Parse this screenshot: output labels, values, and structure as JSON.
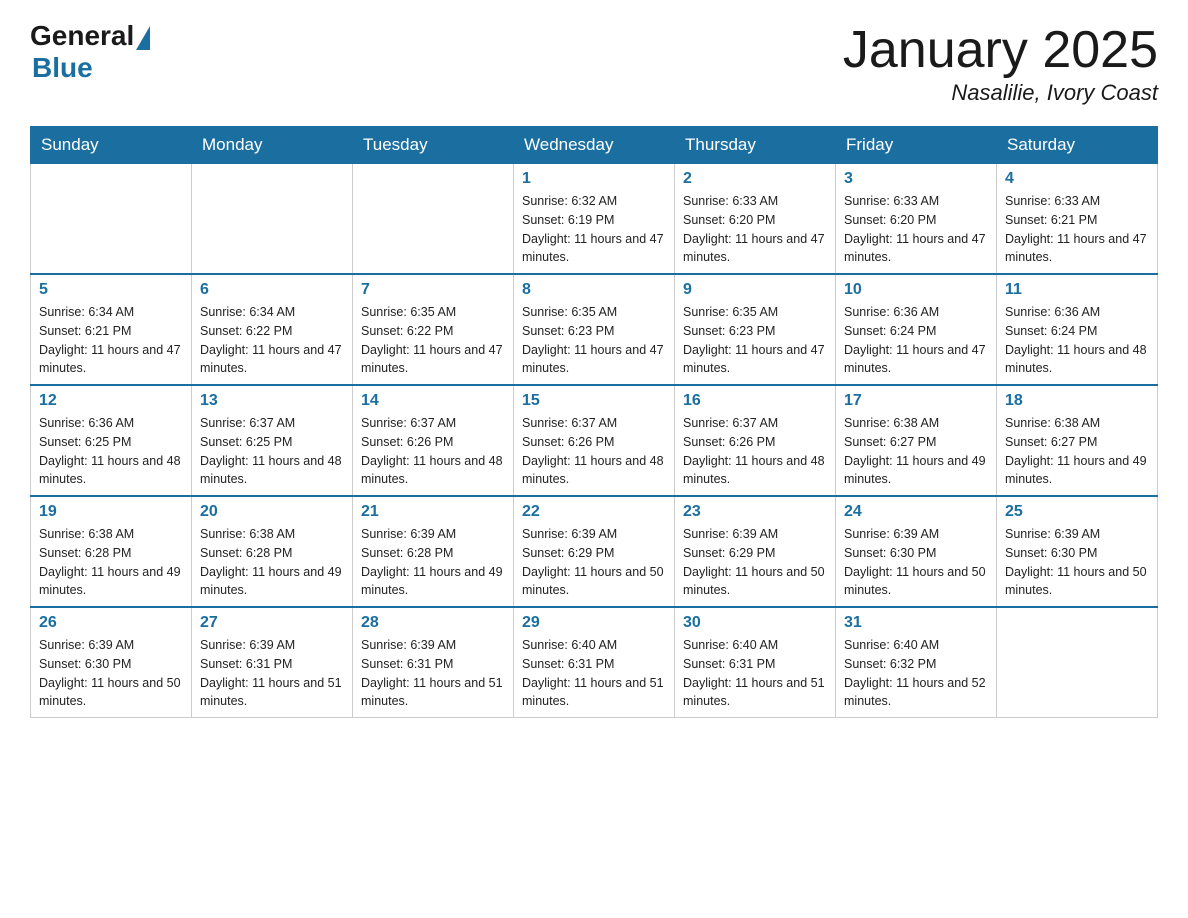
{
  "logo": {
    "general": "General",
    "blue": "Blue"
  },
  "title": "January 2025",
  "location": "Nasalilie, Ivory Coast",
  "days_of_week": [
    "Sunday",
    "Monday",
    "Tuesday",
    "Wednesday",
    "Thursday",
    "Friday",
    "Saturday"
  ],
  "weeks": [
    [
      {
        "day": "",
        "info": ""
      },
      {
        "day": "",
        "info": ""
      },
      {
        "day": "",
        "info": ""
      },
      {
        "day": "1",
        "info": "Sunrise: 6:32 AM\nSunset: 6:19 PM\nDaylight: 11 hours and 47 minutes."
      },
      {
        "day": "2",
        "info": "Sunrise: 6:33 AM\nSunset: 6:20 PM\nDaylight: 11 hours and 47 minutes."
      },
      {
        "day": "3",
        "info": "Sunrise: 6:33 AM\nSunset: 6:20 PM\nDaylight: 11 hours and 47 minutes."
      },
      {
        "day": "4",
        "info": "Sunrise: 6:33 AM\nSunset: 6:21 PM\nDaylight: 11 hours and 47 minutes."
      }
    ],
    [
      {
        "day": "5",
        "info": "Sunrise: 6:34 AM\nSunset: 6:21 PM\nDaylight: 11 hours and 47 minutes."
      },
      {
        "day": "6",
        "info": "Sunrise: 6:34 AM\nSunset: 6:22 PM\nDaylight: 11 hours and 47 minutes."
      },
      {
        "day": "7",
        "info": "Sunrise: 6:35 AM\nSunset: 6:22 PM\nDaylight: 11 hours and 47 minutes."
      },
      {
        "day": "8",
        "info": "Sunrise: 6:35 AM\nSunset: 6:23 PM\nDaylight: 11 hours and 47 minutes."
      },
      {
        "day": "9",
        "info": "Sunrise: 6:35 AM\nSunset: 6:23 PM\nDaylight: 11 hours and 47 minutes."
      },
      {
        "day": "10",
        "info": "Sunrise: 6:36 AM\nSunset: 6:24 PM\nDaylight: 11 hours and 47 minutes."
      },
      {
        "day": "11",
        "info": "Sunrise: 6:36 AM\nSunset: 6:24 PM\nDaylight: 11 hours and 48 minutes."
      }
    ],
    [
      {
        "day": "12",
        "info": "Sunrise: 6:36 AM\nSunset: 6:25 PM\nDaylight: 11 hours and 48 minutes."
      },
      {
        "day": "13",
        "info": "Sunrise: 6:37 AM\nSunset: 6:25 PM\nDaylight: 11 hours and 48 minutes."
      },
      {
        "day": "14",
        "info": "Sunrise: 6:37 AM\nSunset: 6:26 PM\nDaylight: 11 hours and 48 minutes."
      },
      {
        "day": "15",
        "info": "Sunrise: 6:37 AM\nSunset: 6:26 PM\nDaylight: 11 hours and 48 minutes."
      },
      {
        "day": "16",
        "info": "Sunrise: 6:37 AM\nSunset: 6:26 PM\nDaylight: 11 hours and 48 minutes."
      },
      {
        "day": "17",
        "info": "Sunrise: 6:38 AM\nSunset: 6:27 PM\nDaylight: 11 hours and 49 minutes."
      },
      {
        "day": "18",
        "info": "Sunrise: 6:38 AM\nSunset: 6:27 PM\nDaylight: 11 hours and 49 minutes."
      }
    ],
    [
      {
        "day": "19",
        "info": "Sunrise: 6:38 AM\nSunset: 6:28 PM\nDaylight: 11 hours and 49 minutes."
      },
      {
        "day": "20",
        "info": "Sunrise: 6:38 AM\nSunset: 6:28 PM\nDaylight: 11 hours and 49 minutes."
      },
      {
        "day": "21",
        "info": "Sunrise: 6:39 AM\nSunset: 6:28 PM\nDaylight: 11 hours and 49 minutes."
      },
      {
        "day": "22",
        "info": "Sunrise: 6:39 AM\nSunset: 6:29 PM\nDaylight: 11 hours and 50 minutes."
      },
      {
        "day": "23",
        "info": "Sunrise: 6:39 AM\nSunset: 6:29 PM\nDaylight: 11 hours and 50 minutes."
      },
      {
        "day": "24",
        "info": "Sunrise: 6:39 AM\nSunset: 6:30 PM\nDaylight: 11 hours and 50 minutes."
      },
      {
        "day": "25",
        "info": "Sunrise: 6:39 AM\nSunset: 6:30 PM\nDaylight: 11 hours and 50 minutes."
      }
    ],
    [
      {
        "day": "26",
        "info": "Sunrise: 6:39 AM\nSunset: 6:30 PM\nDaylight: 11 hours and 50 minutes."
      },
      {
        "day": "27",
        "info": "Sunrise: 6:39 AM\nSunset: 6:31 PM\nDaylight: 11 hours and 51 minutes."
      },
      {
        "day": "28",
        "info": "Sunrise: 6:39 AM\nSunset: 6:31 PM\nDaylight: 11 hours and 51 minutes."
      },
      {
        "day": "29",
        "info": "Sunrise: 6:40 AM\nSunset: 6:31 PM\nDaylight: 11 hours and 51 minutes."
      },
      {
        "day": "30",
        "info": "Sunrise: 6:40 AM\nSunset: 6:31 PM\nDaylight: 11 hours and 51 minutes."
      },
      {
        "day": "31",
        "info": "Sunrise: 6:40 AM\nSunset: 6:32 PM\nDaylight: 11 hours and 52 minutes."
      },
      {
        "day": "",
        "info": ""
      }
    ]
  ]
}
